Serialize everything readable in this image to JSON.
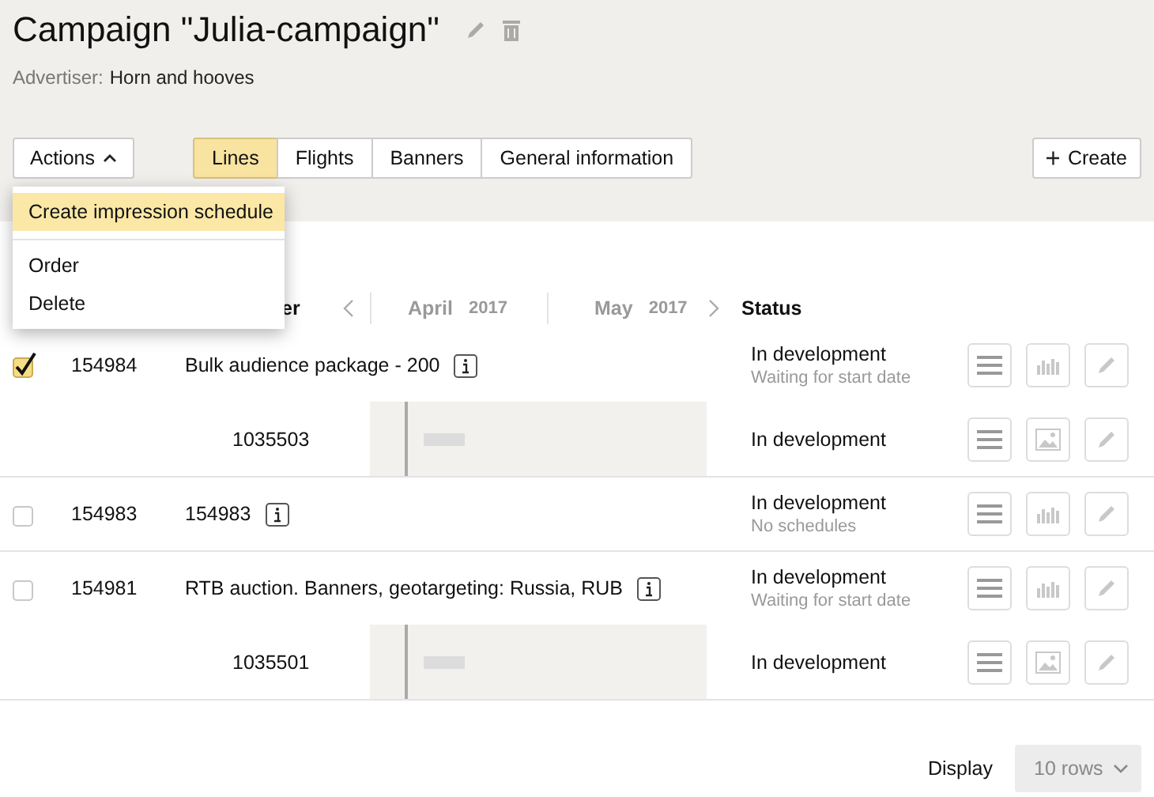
{
  "title": "Campaign \"Julia-campaign\"",
  "advertiser": {
    "label": "Advertiser:",
    "value": "Horn and hooves"
  },
  "actions_button": {
    "label": "Actions",
    "expanded": true
  },
  "tabs": [
    {
      "label": "Lines",
      "selected": true
    },
    {
      "label": "Flights",
      "selected": false
    },
    {
      "label": "Banners",
      "selected": false
    },
    {
      "label": "General information",
      "selected": false
    }
  ],
  "create_button": {
    "label": "Create"
  },
  "actions_menu": [
    {
      "kind": "item",
      "label": "Create impression schedule",
      "selected": true
    },
    {
      "kind": "divider"
    },
    {
      "kind": "item",
      "label": "Order",
      "selected": false
    },
    {
      "kind": "item",
      "label": "Delete",
      "selected": false
    }
  ],
  "table": {
    "name_column": "er",
    "months": [
      {
        "name": "April",
        "year": "2017"
      },
      {
        "name": "May",
        "year": "2017"
      }
    ],
    "status_column": "Status",
    "rows": [
      {
        "checked": true,
        "id": "154984",
        "name": "Bulk audience package - 200",
        "status": "In development",
        "substatus": "Waiting for start date",
        "children": [
          {
            "id": "1035503",
            "status": "In development"
          }
        ]
      },
      {
        "checked": false,
        "id": "154983",
        "name": "154983",
        "status": "In development",
        "substatus": "No schedules"
      },
      {
        "checked": false,
        "id": "154981",
        "name": "RTB auction. Banners, geotargeting: Russia, RUB",
        "status": "In development",
        "substatus": "Waiting for start date",
        "children": [
          {
            "id": "1035501",
            "status": "In development"
          }
        ]
      }
    ]
  },
  "footer": {
    "label": "Display",
    "rows_select": "10 rows"
  }
}
